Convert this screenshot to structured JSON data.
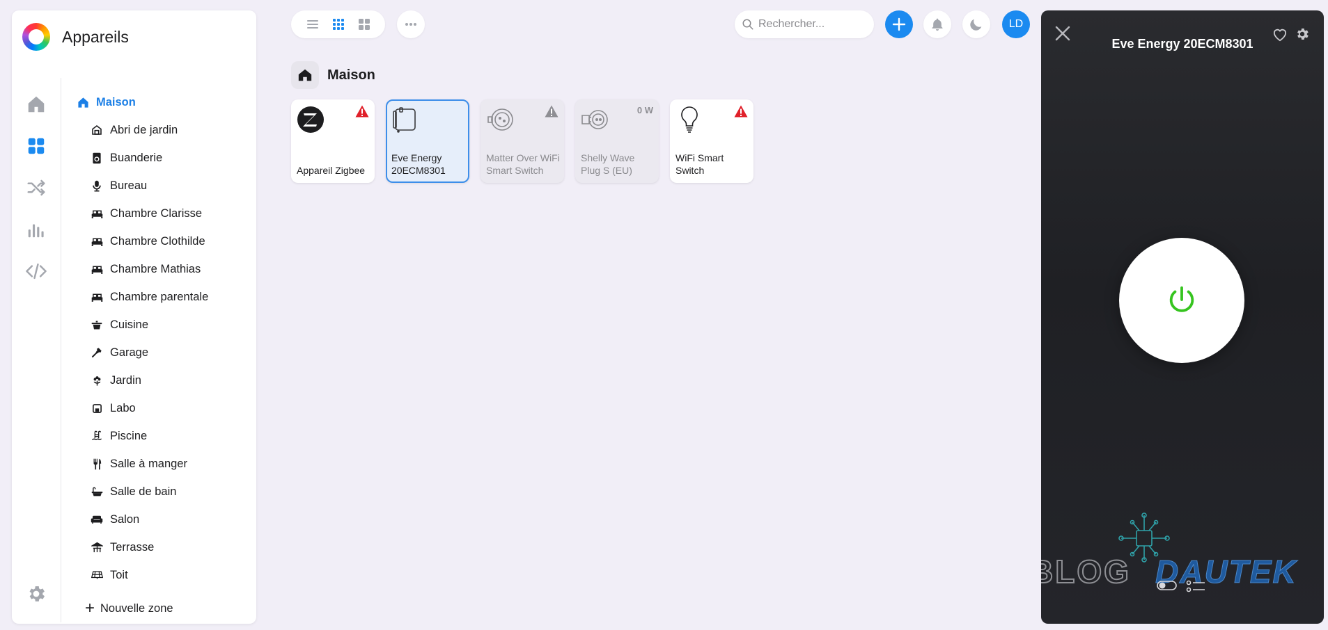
{
  "app": {
    "title": "Appareils"
  },
  "rail": {
    "items": [
      {
        "name": "home-icon",
        "active": false
      },
      {
        "name": "devices-grid-icon",
        "active": true
      },
      {
        "name": "automations-shuffle-icon",
        "active": false
      },
      {
        "name": "statistics-chart-icon",
        "active": false
      },
      {
        "name": "developer-code-icon",
        "active": false
      }
    ],
    "settings": "gear-icon"
  },
  "zones": [
    {
      "label": "Maison",
      "icon": "house-icon",
      "active": true
    },
    {
      "label": "Abri de jardin",
      "icon": "shed-icon"
    },
    {
      "label": "Buanderie",
      "icon": "washing-machine-icon"
    },
    {
      "label": "Bureau",
      "icon": "microphone-icon"
    },
    {
      "label": "Chambre Clarisse",
      "icon": "bed-icon"
    },
    {
      "label": "Chambre Clothilde",
      "icon": "bed-icon"
    },
    {
      "label": "Chambre Mathias",
      "icon": "bed-icon"
    },
    {
      "label": "Chambre parentale",
      "icon": "bed-icon"
    },
    {
      "label": "Cuisine",
      "icon": "pot-icon"
    },
    {
      "label": "Garage",
      "icon": "hammer-icon"
    },
    {
      "label": "Jardin",
      "icon": "flower-icon"
    },
    {
      "label": "Labo",
      "icon": "flask-icon"
    },
    {
      "label": "Piscine",
      "icon": "pool-icon"
    },
    {
      "label": "Salle à manger",
      "icon": "cutlery-icon"
    },
    {
      "label": "Salle de bain",
      "icon": "bathtub-icon"
    },
    {
      "label": "Salon",
      "icon": "sofa-icon"
    },
    {
      "label": "Terrasse",
      "icon": "patio-icon"
    },
    {
      "label": "Toit",
      "icon": "solar-panel-icon"
    }
  ],
  "new_zone": {
    "label": "Nouvelle zone"
  },
  "toolbar": {
    "search_placeholder": "Rechercher...",
    "avatar_initials": "LD"
  },
  "section": {
    "title": "Maison"
  },
  "devices": [
    {
      "name": "Appareil Zigbee",
      "icon": "zigbee-logo-icon",
      "status": "warning-red",
      "active": true
    },
    {
      "name": "Eve Energy 20ECM8301",
      "icon": "eve-energy-plug-icon",
      "status": "none",
      "selected": true
    },
    {
      "name": "Matter Over WiFi Smart Switch",
      "icon": "smart-plug-icon",
      "status": "warning-grey",
      "active": false
    },
    {
      "name": "Shelly Wave Plug S (EU)",
      "icon": "smart-plug-icon",
      "power": "0 W",
      "active": false
    },
    {
      "name": "WiFi Smart Switch",
      "icon": "light-bulb-icon",
      "status": "warning-red",
      "active": true
    }
  ],
  "detail": {
    "title": "Eve Energy 20ECM8301",
    "power_state": "on"
  },
  "watermark": {
    "word1": "BLOG",
    "word2": "DAUTEK"
  },
  "colors": {
    "accent": "#1b8af0",
    "warning": "#e0202a",
    "power_on": "#36c41f",
    "panel_dark": "#212226"
  }
}
